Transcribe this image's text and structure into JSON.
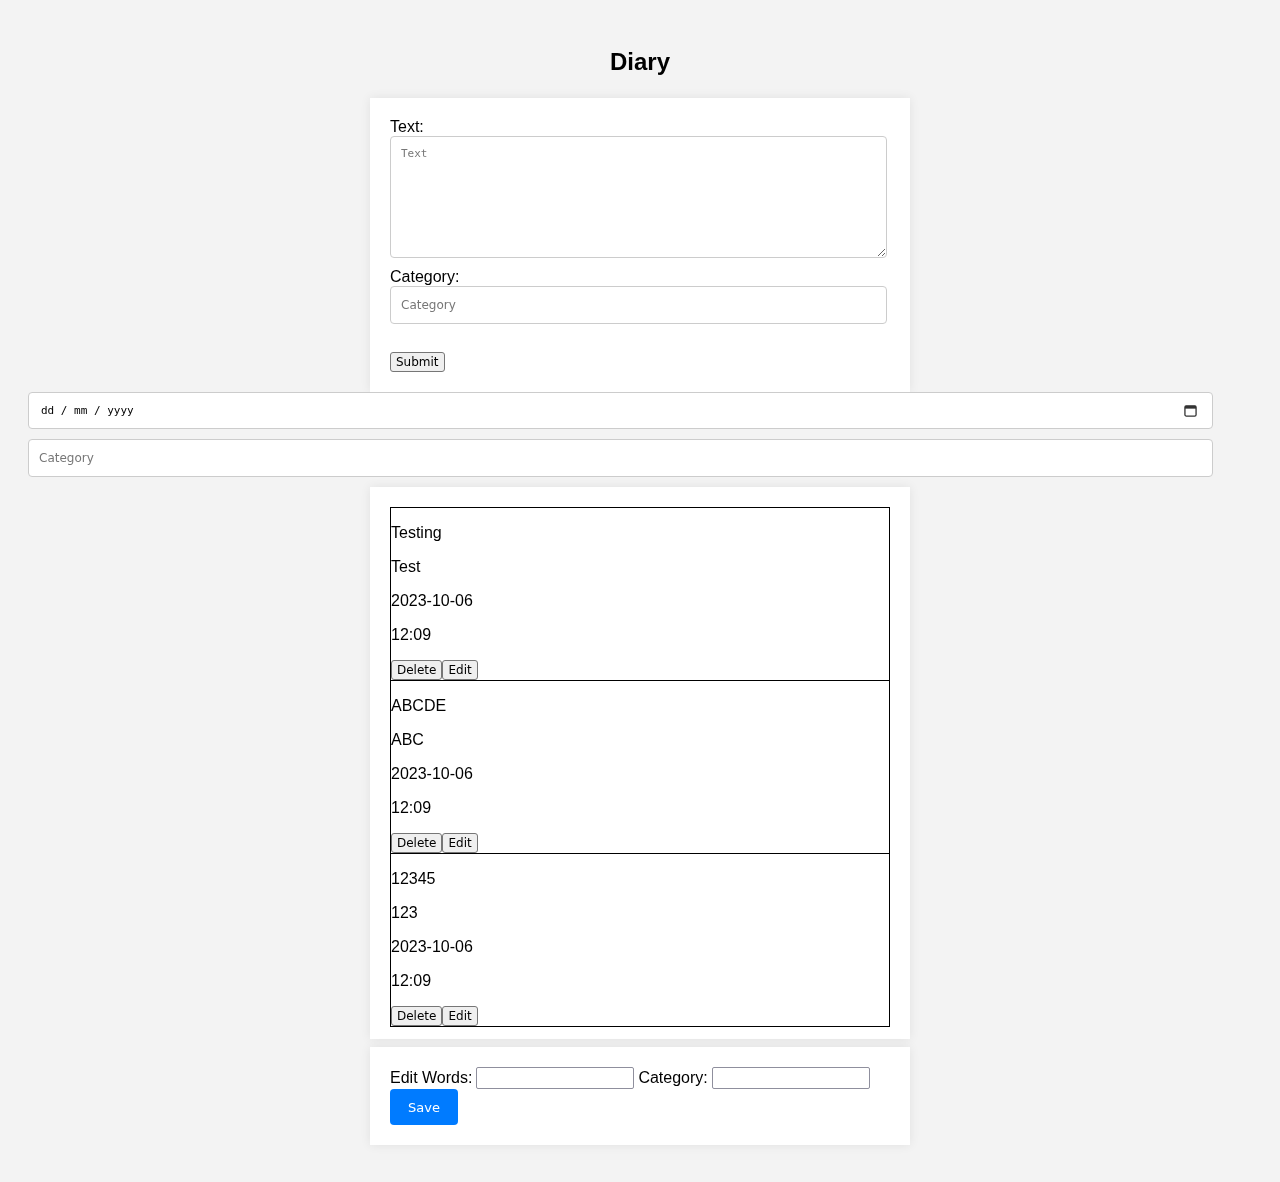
{
  "title": "Diary",
  "form": {
    "text_label": "Text:",
    "text_placeholder": "Text",
    "category_label": "Category:",
    "category_placeholder": "Category",
    "submit": "Submit"
  },
  "filters": {
    "date_placeholder": "dd / mm / yyyy",
    "category_placeholder": "Category"
  },
  "entries": [
    {
      "text": "Testing",
      "category": "Test",
      "date": "2023-10-06",
      "time": "12:09",
      "delete": "Delete",
      "edit": "Edit"
    },
    {
      "text": "ABCDE",
      "category": "ABC",
      "date": "2023-10-06",
      "time": "12:09",
      "delete": "Delete",
      "edit": "Edit"
    },
    {
      "text": "12345",
      "category": "123",
      "date": "2023-10-06",
      "time": "12:09",
      "delete": "Delete",
      "edit": "Edit"
    }
  ],
  "edit_form": {
    "words_label": "Edit Words:",
    "category_label": "Category:",
    "save": "Save"
  }
}
